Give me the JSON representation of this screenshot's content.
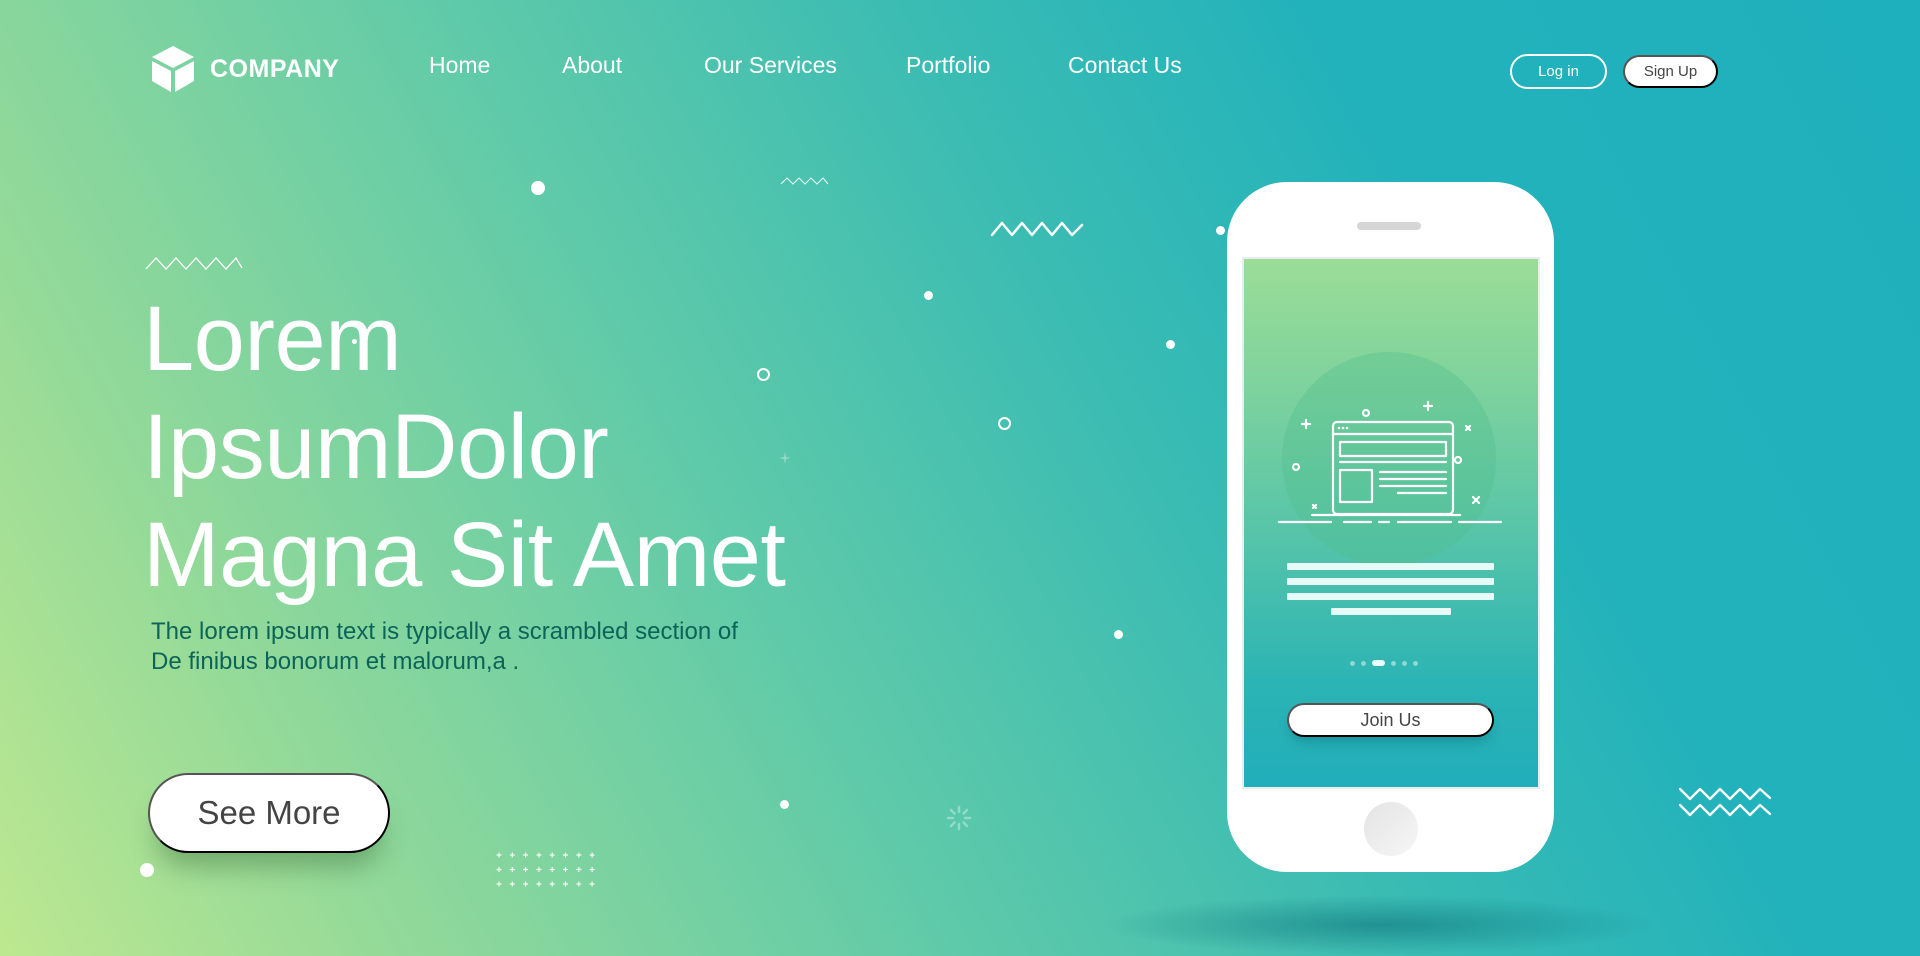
{
  "brand": {
    "name": "COMPANY",
    "logo_icon": "cube-icon"
  },
  "nav": {
    "links": [
      "Home",
      "About",
      "Our Services",
      "Portfolio",
      "Contact Us"
    ],
    "login_label": "Log in",
    "signup_label": "Sign Up"
  },
  "hero": {
    "title_lines": [
      "Lorem",
      "IpsumDolor",
      "Magna Sit Amet"
    ],
    "subtitle_lines": [
      "The lorem ipsum text is typically a scrambled section of",
      "De finibus bonorum et malorum,a ."
    ],
    "cta_label": "See More"
  },
  "phone": {
    "illustration_icon": "browser-window-icon",
    "pager": {
      "count": 6,
      "active_index": 2
    },
    "cta_label": "Join Us"
  },
  "colors": {
    "gradient_start": "#bde890",
    "gradient_end": "#1eb0bd",
    "subtitle_text": "#0c6458",
    "button_text": "#444444"
  }
}
